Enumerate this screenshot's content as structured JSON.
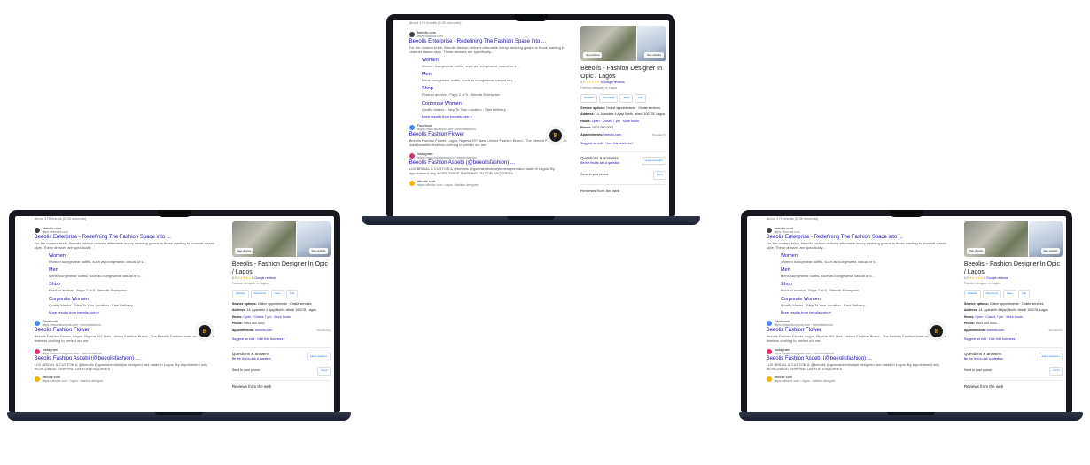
{
  "serp": {
    "stats": "About 179 results (0.30 seconds)",
    "result1": {
      "site_name": "beeolis.com",
      "site_url": "https://beeolis.com",
      "title": "Beeolis Enterprise - Redefining The Fashion Space into ...",
      "snippet": "For the modern bride, Beeolis fashion delivers affordable luxury wedding gowns to those wanting to channel classic style. These dresses are specifically..."
    },
    "sitelinks": [
      {
        "title": "Women",
        "snippet": "Women loungewear outfits, such as loungewear, casual or s..."
      },
      {
        "title": "Men",
        "snippet": "Mens loungewear outfits, such as loungewear, casual or s..."
      },
      {
        "title": "Shop",
        "snippet": "Product archive - Page 2 of 5 - Beeolis Enterprise."
      },
      {
        "title": "Corporate Women",
        "snippet": "Quality Makes - Step To Your Location - Fast Delivery..."
      }
    ],
    "more_results": "More results from beeolis.com »",
    "result2": {
      "site_name": "Facebook",
      "site_url": "https://www.facebook.com › beeolisfashion",
      "title": "Beeolis Fashion Flower",
      "snippet": "Beeolis Fashion Flower, Lagos, Nigeria 297 likes. Unisex Fashion Brand - The Beeolis Fashion team want beautiful timeless clothing to prefect our me"
    },
    "result3": {
      "site_name": "Instagram",
      "site_url": "https://www.instagram.com › beeolisfashion",
      "title": "Beeolis Fashion Asoebi (@beeolisfashion) ...",
      "snippet": "LUX BRIDAL & CUSTOM & @beeolis @gownsbeeolisstyle designed and made in Lagos. By appointment only WORLDWIDE SHIPPING DM FOR ENQUIRIES"
    },
    "result4": {
      "site_name": "afrodiz.com",
      "site_url": "https://afrodiz.com › lagos › fashion-designer"
    },
    "logo_letter": "B"
  },
  "panel": {
    "photo_btn_left": "See photos",
    "photo_btn_right": "See outside",
    "business_name": "Beeolis - Fashion Designer In Opic / Lagos",
    "rating_value": "5.0",
    "stars": "★★★★★",
    "reviews": "8 Google reviews",
    "category": "Fashion designer in Lagos",
    "chips": [
      "Website",
      "Directions",
      "Save",
      "Call"
    ],
    "service_label": "Service options:",
    "service_value": "Online appointments · Onsite services",
    "address_label": "Address:",
    "address_value": "14, Ayandele 4 Ajayi North, Ishedi 100278, Lagos",
    "hours_label": "Hours:",
    "hours_value": "Open · Closes 7 pm · More hours",
    "phone_label": "Phone:",
    "phone_value": "0903 000 0001",
    "appointments_label": "Appointments:",
    "appointments_value": "beeolis.com",
    "provider": "Provided by",
    "suggest_edit": "Suggest an edit · Own this business?",
    "qa_title": "Questions & answers",
    "qa_sub": "Be the first to ask a question",
    "ask_button": "Ask a question",
    "send_phone": "Send to your phone",
    "send_button": "Send",
    "reviews_web": "Reviews from the web"
  },
  "colors": {
    "laptop_frame": "#16181d",
    "laptop_base": "#252c3b",
    "link_blue": "#1a0dab",
    "star_yellow": "#fbbc04"
  }
}
